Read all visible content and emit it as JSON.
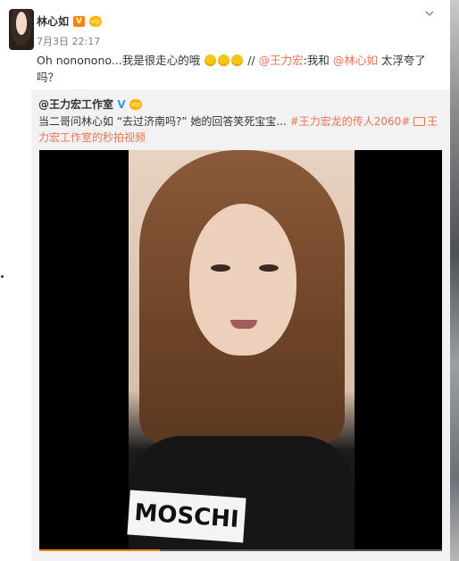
{
  "post": {
    "author": "林心如",
    "vip_badge": "vip",
    "verified_badge": "V",
    "time": "7月3日 22:17",
    "text_part1": "Oh nononono...我是很走心的哦",
    "text_part2": "//",
    "mention1": "@王力宏",
    "text_part3": ":我和",
    "mention2": "@林心如",
    "text_part4": "太浮夸了吗？"
  },
  "repost": {
    "author": "@王力宏工作室",
    "verified_badge": "V",
    "vip_badge": "vip",
    "text": "当二哥问林心如 “去过济南吗?” 她的回答笑死宝宝...",
    "hashtag": "#王力宏龙的传人2060#",
    "video_link": "王力宏工作室的秒拍视频",
    "shirt_text": "MOSCHI",
    "video_progress_pct": 30
  },
  "colors": {
    "accent": "#eb7350",
    "badge_orange": "#ff8200",
    "repost_bg": "#f2f2f5"
  },
  "icons": [
    "chevron-down-icon",
    "emoji-laugh-icon",
    "video-icon"
  ]
}
